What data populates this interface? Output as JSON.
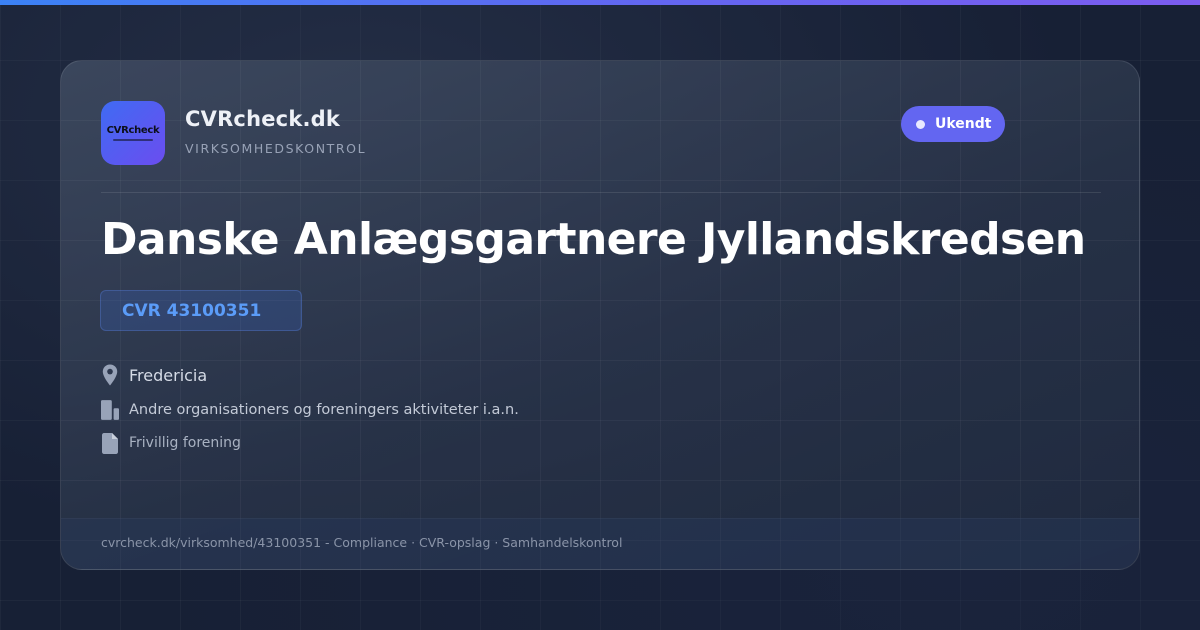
{
  "colors": {
    "accent": "#6366f1",
    "accent_blue": "#3b82f6",
    "cvr_text": "#5b9cf8",
    "background": "#172035"
  },
  "brand": {
    "logo_text": "CVRcheck",
    "name": "CVRcheck.dk",
    "tagline": "VIRKSOMHEDSKONTROL"
  },
  "status": {
    "label": "Ukendt",
    "icon": "status-dot-icon"
  },
  "company": {
    "name": "Danske Anlægsgartnere Jyllandskredsen",
    "cvr": "CVR 43100351",
    "city": "Fredericia",
    "industry": "Andre organisationers og foreningers aktiviteter i.a.n.",
    "form": "Frivillig forening"
  },
  "icons": {
    "city": "map-pin-icon",
    "industry": "building-icon",
    "form": "document-icon"
  },
  "footer": {
    "text": "cvrcheck.dk/virksomhed/43100351 - Compliance · CVR-opslag · Samhandelskontrol"
  }
}
